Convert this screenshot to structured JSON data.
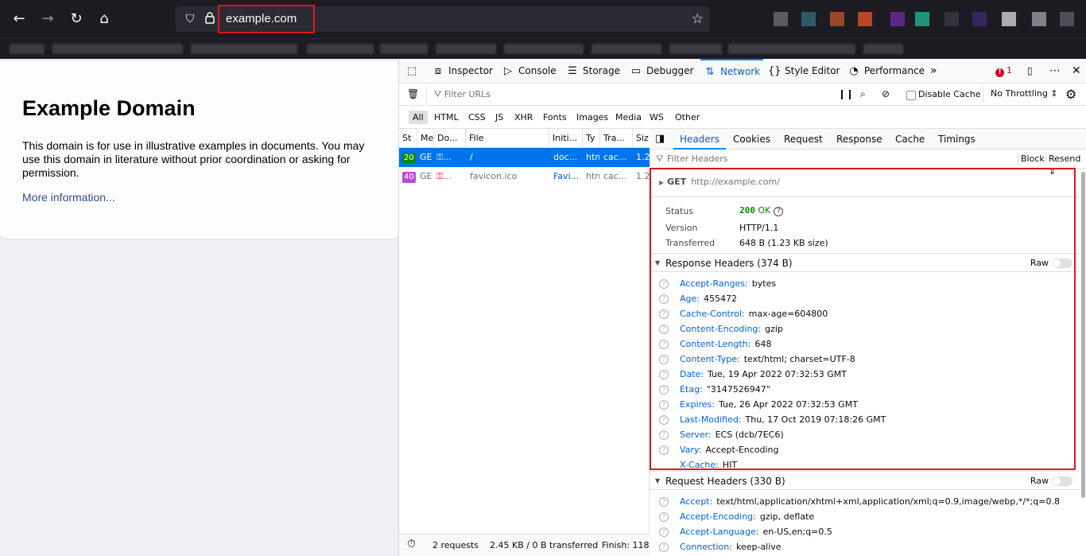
{
  "browser": {
    "url": "example.com"
  },
  "page": {
    "heading": "Example Domain",
    "paragraph": "This domain is for use in illustrative examples in documents. You may use this domain in literature without prior coordination or asking for permission.",
    "link": "More information..."
  },
  "devtools": {
    "tabs": [
      {
        "label": "Inspector",
        "icon": "inspector-icon"
      },
      {
        "label": "Console",
        "icon": "console-icon"
      },
      {
        "label": "Storage",
        "icon": "storage-icon"
      },
      {
        "label": "Debugger",
        "icon": "debugger-icon"
      },
      {
        "label": "Network",
        "icon": "network-icon"
      },
      {
        "label": "Style Editor",
        "icon": "style-editor-icon"
      },
      {
        "label": "Performance",
        "icon": "performance-icon"
      }
    ],
    "active_tab": "Network",
    "error_count": "1",
    "filter_urls_placeholder": "Filter URLs",
    "disable_cache": "Disable Cache",
    "throttling": "No Throttling",
    "type_filters": [
      "All",
      "HTML",
      "CSS",
      "JS",
      "XHR",
      "Fonts",
      "Images",
      "Media",
      "WS",
      "Other"
    ],
    "columns": [
      "St",
      "Me",
      "Do...",
      "File",
      "Initi...",
      "Ty",
      "Tra...",
      "Siz"
    ],
    "requests": [
      {
        "status": "20",
        "method": "GE",
        "domain": "...",
        "file": "/",
        "initiator": "doc...",
        "type": "htn",
        "transferred": "cac...",
        "size": "1.2"
      },
      {
        "status": "40",
        "method": "GE",
        "domain": "...",
        "file": "favicon.ico",
        "initiator": "Favi...",
        "type": "htn",
        "transferred": "cac...",
        "size": "1.2"
      }
    ],
    "summary": {
      "requests": "2 requests",
      "transferred": "2.45 KB / 0 B transferred",
      "finish": "Finish: 118 r"
    },
    "detail_tabs": [
      "Headers",
      "Cookies",
      "Request",
      "Response",
      "Cache",
      "Timings"
    ],
    "filter_headers_placeholder": "Filter Headers",
    "block_label": "Block",
    "resend_label": "Resend",
    "request_method": "GET",
    "request_url": "http://example.com/",
    "status_label": "Status",
    "status_code": "200",
    "status_text": "OK",
    "version_label": "Version",
    "version": "HTTP/1.1",
    "transferred_label": "Transferred",
    "transferred": "648 B (1.23 KB size)",
    "response_headers_title": "Response Headers (374 B)",
    "raw_label": "Raw",
    "response_headers": [
      {
        "name": "Accept-Ranges:",
        "value": "bytes"
      },
      {
        "name": "Age:",
        "value": "455472"
      },
      {
        "name": "Cache-Control:",
        "value": "max-age=604800"
      },
      {
        "name": "Content-Encoding:",
        "value": "gzip"
      },
      {
        "name": "Content-Length:",
        "value": "648"
      },
      {
        "name": "Content-Type:",
        "value": "text/html; charset=UTF-8"
      },
      {
        "name": "Date:",
        "value": "Tue, 19 Apr 2022 07:32:53 GMT"
      },
      {
        "name": "Etag:",
        "value": "\"3147526947\""
      },
      {
        "name": "Expires:",
        "value": "Tue, 26 Apr 2022 07:32:53 GMT"
      },
      {
        "name": "Last-Modified:",
        "value": "Thu, 17 Oct 2019 07:18:26 GMT"
      },
      {
        "name": "Server:",
        "value": "ECS (dcb/7EC6)"
      },
      {
        "name": "Vary:",
        "value": "Accept-Encoding"
      },
      {
        "name": "X-Cache:",
        "value": "HIT"
      }
    ],
    "request_headers_title": "Request Headers (330 B)",
    "request_headers": [
      {
        "name": "Accept:",
        "value": "text/html,application/xhtml+xml,application/xml;q=0.9,image/webp,*/*;q=0.8"
      },
      {
        "name": "Accept-Encoding:",
        "value": "gzip, deflate"
      },
      {
        "name": "Accept-Language:",
        "value": "en-US,en;q=0.5"
      },
      {
        "name": "Connection:",
        "value": "keep-alive"
      }
    ]
  },
  "colors": {
    "accent": "#0a84ff",
    "selected_row": "#0074e8",
    "highlight": "#e0161e",
    "status_200": "#058b00",
    "status_404": "#b84cd8",
    "header_name": "#0060df"
  }
}
